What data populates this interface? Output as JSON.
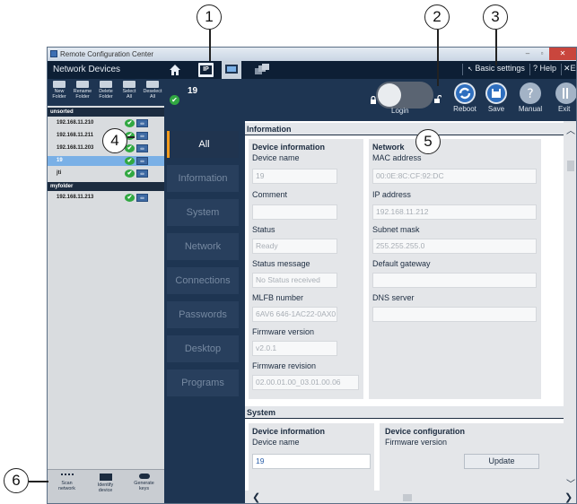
{
  "window": {
    "title": "Remote Configuration Center"
  },
  "top_nav": {
    "title": "Network Devices",
    "tab_ip_label": "IP",
    "basic_settings": "Basic settings",
    "help": "? Help",
    "exit": "Ex"
  },
  "left_toolbar": [
    {
      "label1": "New",
      "label2": "Folder"
    },
    {
      "label1": "Rename",
      "label2": "Folder"
    },
    {
      "label1": "Delete",
      "label2": "Folder"
    },
    {
      "label1": "Select",
      "label2": "All"
    },
    {
      "label1": "Deselect",
      "label2": "All"
    }
  ],
  "device_tree": {
    "groups": [
      {
        "name": "unsorted"
      },
      {
        "name": "myfolder"
      }
    ],
    "devices": [
      {
        "name": "192.168.11.210",
        "selected": false
      },
      {
        "name": "192.168.11.211",
        "selected": false
      },
      {
        "name": "192.168.11.203",
        "selected": false
      },
      {
        "name": "19",
        "selected": true
      },
      {
        "name": "jti",
        "selected": false
      },
      {
        "name": "192.168.11.213",
        "selected": false
      }
    ],
    "status_ok_symbol": "✔"
  },
  "left_bottom": [
    {
      "label1": "Scan",
      "label2": "network"
    },
    {
      "label1": "Identify",
      "label2": "device"
    },
    {
      "label1": "Generate",
      "label2": "keys"
    }
  ],
  "device_header": {
    "name": "19",
    "login": "Login",
    "reboot": "Reboot",
    "save": "Save",
    "manual": "Manual",
    "exit": "Exit"
  },
  "nav": {
    "items": [
      "All",
      "Information",
      "System",
      "Network",
      "Connections",
      "Passwords",
      "Desktop",
      "Programs"
    ],
    "active": "All"
  },
  "information": {
    "title": "Information",
    "device_card_title": "Device information",
    "device_name_label": "Device name",
    "device_name": "19",
    "comment_label": "Comment",
    "comment": "",
    "status_label": "Status",
    "status": "Ready",
    "status_message_label": "Status message",
    "status_message": "No Status received",
    "mlfb_label": "MLFB number",
    "mlfb": "6AV6 646-1AC22-0AX0",
    "firmware_version_label": "Firmware version",
    "firmware_version": "v2.0.1",
    "firmware_revision_label": "Firmware revision",
    "firmware_revision": "02.00.01.00_03.01.00.06",
    "network_card_title": "Network",
    "mac_label": "MAC address",
    "mac": "00:0E:8C:CF:92:DC",
    "ip_label": "IP address",
    "ip": "192.168.11.212",
    "subnet_label": "Subnet mask",
    "subnet": "255.255.255.0",
    "gateway_label": "Default gateway",
    "gateway": "",
    "dns_label": "DNS server",
    "dns": ""
  },
  "system": {
    "title": "System",
    "device_card_title": "Device information",
    "device_name_label": "Device name",
    "device_name": "19",
    "config_card_title": "Device configuration",
    "firmware_version_label": "Firmware version",
    "update_button": "Update"
  },
  "callouts": [
    "1",
    "2",
    "3",
    "4",
    "5",
    "6"
  ],
  "colors": {
    "nav_bg": "#1e3552",
    "accent_orange": "#f29b1d",
    "ok_green": "#31a842",
    "action_blue": "#2f6fbf",
    "selected_row": "#7ab0e6"
  }
}
